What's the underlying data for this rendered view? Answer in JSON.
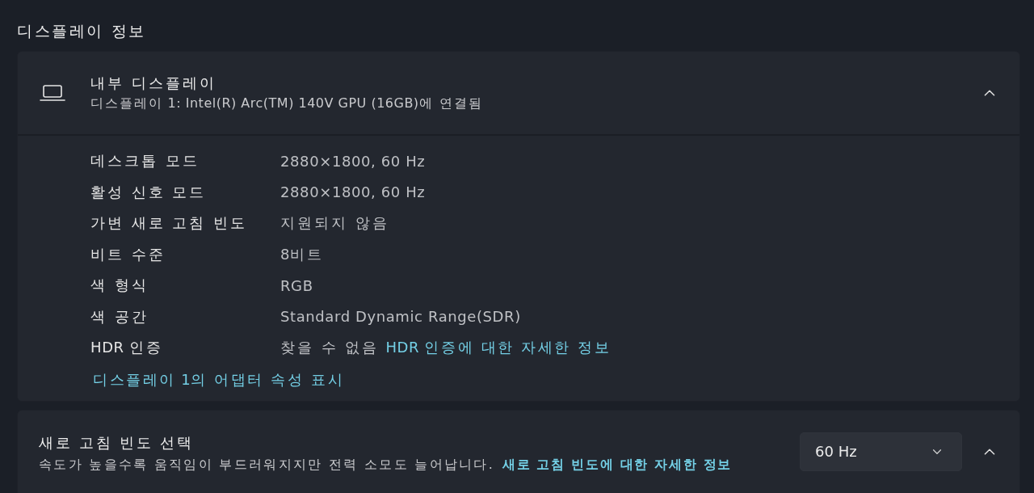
{
  "page": {
    "title": "디스플레이 정보"
  },
  "display_card": {
    "title": "내부 디스플레이",
    "subtitle": "디스플레이 1: Intel(R) Arc(TM) 140V GPU (16GB)에 연결됨",
    "expanded": true,
    "properties": [
      {
        "label": "데스크톱 모드",
        "value": "2880×1800, 60 Hz"
      },
      {
        "label": "활성 신호 모드",
        "value": "2880×1800, 60 Hz"
      },
      {
        "label": "가변 새로 고침 빈도",
        "value": "지원되지 않음"
      },
      {
        "label": "비트 수준",
        "value": "8비트"
      },
      {
        "label": "색 형식",
        "value": "RGB"
      },
      {
        "label": "색 공간",
        "value": "Standard Dynamic Range(SDR)"
      },
      {
        "label": "HDR 인증",
        "value": "찾을 수 없음",
        "link": "HDR 인증에 대한 자세한 정보"
      }
    ],
    "adapter_link": "디스플레이 1의 어댑터 속성 표시"
  },
  "refresh_card": {
    "title": "새로 고침 빈도 선택",
    "description": "속도가 높을수록 움직임이 부드러워지지만 전력 소모도 늘어납니다.",
    "link": "새로 고침 빈도에 대한 자세한 정보",
    "dropdown": {
      "value": "60 Hz"
    },
    "expanded": true
  }
}
